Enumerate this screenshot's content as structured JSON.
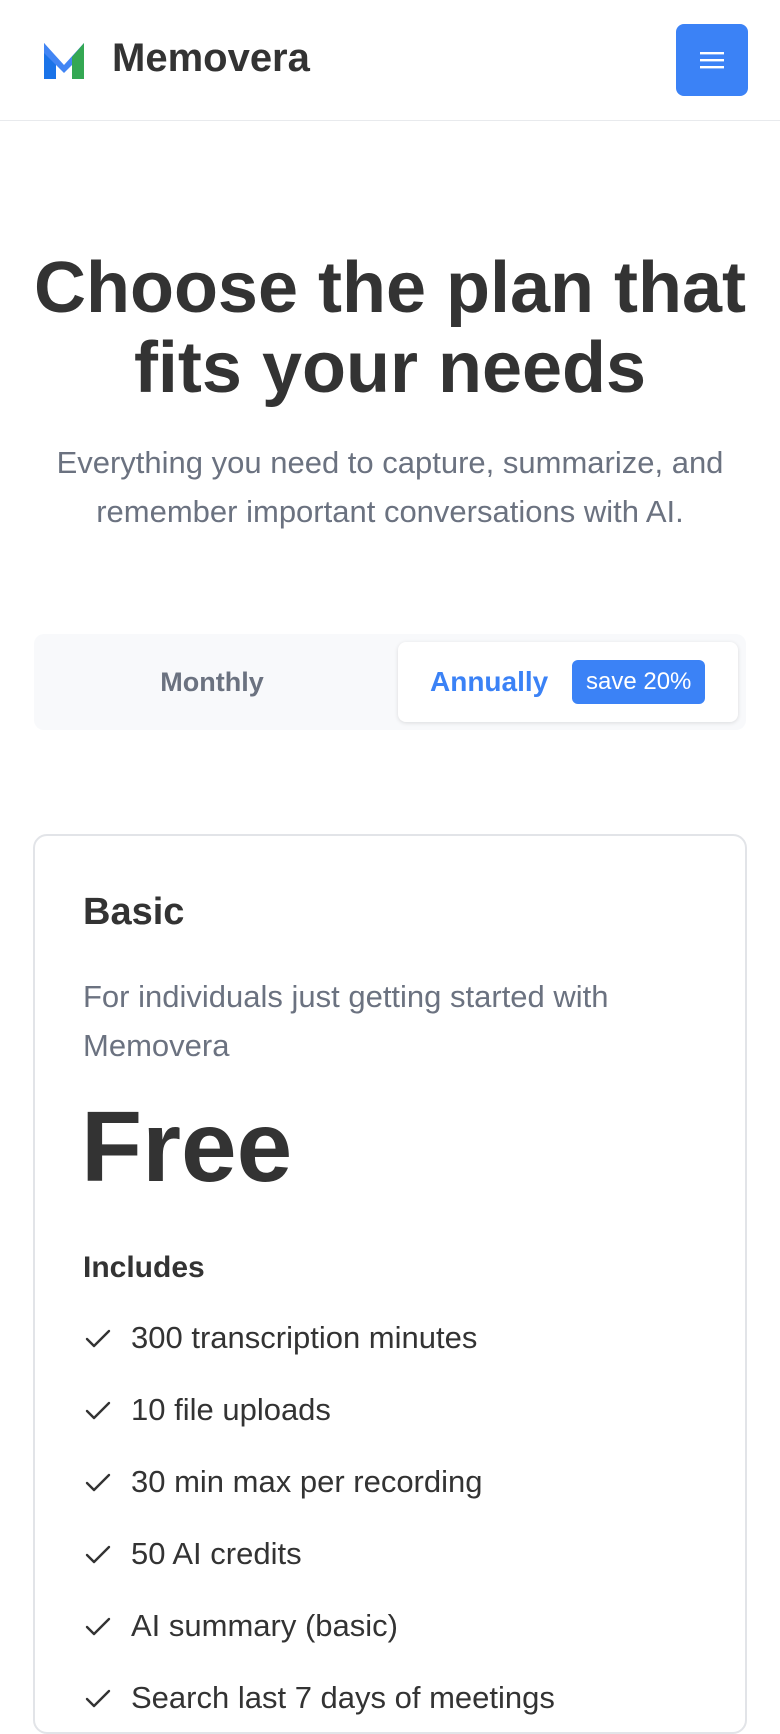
{
  "header": {
    "brand": "Memovera",
    "menu_icon": "hamburger-icon",
    "accent_color": "#3b82f6"
  },
  "hero": {
    "title": "Choose the plan that fits your needs",
    "subtitle": "Everything you need to capture, summarize, and remember important conversations with AI."
  },
  "billing_toggle": {
    "monthly_label": "Monthly",
    "annual_label": "Annually",
    "annual_badge": "save 20%",
    "selected": "Annually"
  },
  "plan": {
    "name": "Basic",
    "description": "For individuals just getting started with Memovera",
    "price": "Free",
    "includes_label": "Includes",
    "features": [
      "300 transcription minutes",
      "10 file uploads",
      "30 min max per recording",
      "50 AI credits",
      "AI summary (basic)",
      "Search last 7 days of meetings"
    ]
  }
}
